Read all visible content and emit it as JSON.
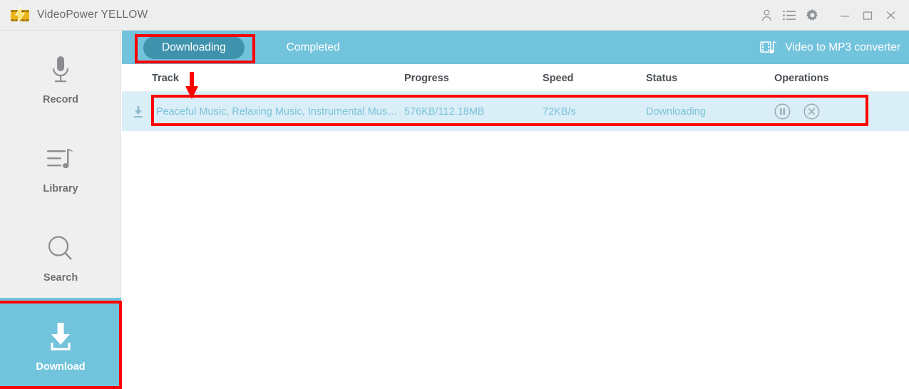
{
  "window": {
    "title": "VideoPower YELLOW",
    "logo_icon": "videopower-logo-icon",
    "tray_icons": [
      {
        "name": "account-icon",
        "label": "Account"
      },
      {
        "name": "list-icon",
        "label": "Task list"
      },
      {
        "name": "gear-icon",
        "label": "Settings"
      }
    ],
    "controls": [
      {
        "name": "minimize-button",
        "glyph": "–"
      },
      {
        "name": "maximize-button",
        "glyph": "□"
      },
      {
        "name": "close-button",
        "glyph": "×"
      }
    ]
  },
  "sidebar": {
    "items": [
      {
        "label": "Record",
        "icon": "microphone-icon",
        "active": false
      },
      {
        "label": "Library",
        "icon": "playlist-music-icon",
        "active": false
      },
      {
        "label": "Search",
        "icon": "search-icon",
        "active": false
      },
      {
        "label": "Download",
        "icon": "download-icon",
        "active": true
      }
    ]
  },
  "tabs": {
    "items": [
      {
        "label": "Downloading",
        "active": true
      },
      {
        "label": "Completed",
        "active": false
      }
    ],
    "converter": {
      "label": "Video to MP3 converter",
      "icon": "video-to-mp3-icon"
    }
  },
  "table": {
    "columns": [
      "Track",
      "Progress",
      "Speed",
      "Status",
      "Operations"
    ],
    "rows": [
      {
        "icon": "download-arrow-icon",
        "track": "Peaceful Music, Relaxing Music, Instrumental Mus…",
        "progress": "576KB/112.18MB",
        "speed": "72KB/s",
        "status": "Downloading",
        "operations": [
          {
            "name": "pause-button",
            "label": "Pause"
          },
          {
            "name": "cancel-button",
            "label": "Cancel"
          }
        ]
      }
    ]
  },
  "annotations": {
    "highlight_color": "#fd0000",
    "boxes": [
      {
        "name": "downloading-tab-highlight"
      },
      {
        "name": "download-row-highlight"
      },
      {
        "name": "download-sidebar-highlight"
      }
    ],
    "arrow": {
      "name": "track-pointer-arrow",
      "direction": "down"
    }
  },
  "colors": {
    "accent": "#72c3dc",
    "accent_dark": "#3f93ad",
    "row_bg": "#d9eef6",
    "titlebar_bg": "#eeeeee",
    "sidebar_bg": "#efefef"
  }
}
